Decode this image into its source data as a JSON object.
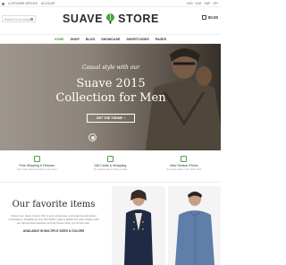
{
  "topbar": {
    "left_items": [
      "CUSTOMER SERVICE",
      "ACCOUNT"
    ],
    "right_items": [
      "USD",
      "EUR",
      "GBP",
      "JPY"
    ]
  },
  "header": {
    "search_placeholder": "Search for products",
    "logo_left": "SUAVE",
    "logo_right": "STORE",
    "cart_total": "$0.00"
  },
  "nav": {
    "items": [
      "HOME",
      "SHOP",
      "BLOG",
      "SHOWCASE",
      "SHORTCODES",
      "PAGES"
    ]
  },
  "hero": {
    "script": "Casual style with our",
    "headline_1": "Suave 2015",
    "headline_2": "Collection for Men",
    "cta": "GET THE THEME"
  },
  "features": [
    {
      "title": "Free Shipping & Returns",
      "subtitle": "Your order delivered right to your door"
    },
    {
      "title": "Gift Cards & Wrapping",
      "subtitle": "the perfect way to bring a smile"
    },
    {
      "title": "New Season Prices",
      "subtitle": "Get great deals in our 2015 store"
    }
  ],
  "favorites": {
    "title": "Our favorite items",
    "description": "Dress it up, dress it down, this is your all-purpose, everyday top and jacket combination. Available for less than $200, make a splash this party season with our hand-picked selection and get Suave when you hit the town.",
    "availability": "AVAILABLE IN MULTIPLE SIZES & COLORS"
  },
  "colors": {
    "accent": "#4c9f43"
  }
}
